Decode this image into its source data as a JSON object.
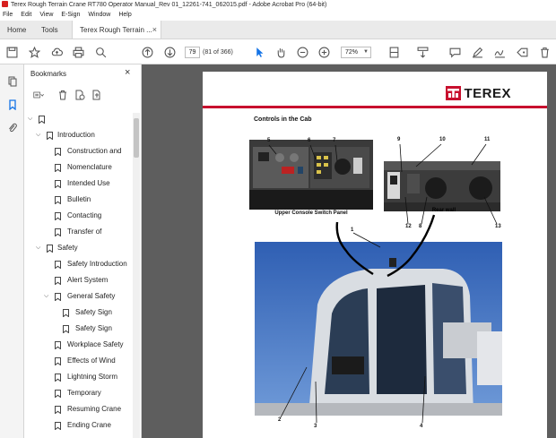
{
  "window": {
    "title": "Terex Rough Terrain Crane RT780 Operator Manual_Rev 01_12261-741_062015.pdf - Adobe Acrobat Pro (64-bit)"
  },
  "menu": [
    "File",
    "Edit",
    "View",
    "E-Sign",
    "Window",
    "Help"
  ],
  "tabs": {
    "home": "Home",
    "tools": "Tools",
    "document": "Terex Rough Terrain ..."
  },
  "toolbar": {
    "page_number": "79",
    "page_count": "(81 of 366)",
    "zoom": "72%"
  },
  "bookmarks": {
    "title": "Bookmarks",
    "items": [
      {
        "label": "",
        "expanded": true
      },
      {
        "label": "Introduction",
        "expanded": true
      },
      {
        "label": "Construction and"
      },
      {
        "label": "Nomenclature"
      },
      {
        "label": "Intended Use"
      },
      {
        "label": "Bulletin"
      },
      {
        "label": "Contacting"
      },
      {
        "label": "Transfer of"
      },
      {
        "label": "Safety",
        "expanded": true
      },
      {
        "label": "Safety Introduction"
      },
      {
        "label": "Alert System"
      },
      {
        "label": "General Safety",
        "expanded": true
      },
      {
        "label": "Safety Sign"
      },
      {
        "label": "Safety Sign"
      },
      {
        "label": "Workplace Safety"
      },
      {
        "label": "Effects of Wind"
      },
      {
        "label": "Lightning Storm"
      },
      {
        "label": "Temporary"
      },
      {
        "label": "Resuming Crane"
      },
      {
        "label": "Ending Crane"
      }
    ]
  },
  "document_page": {
    "brand": "TEREX",
    "heading": "Controls in the Cab",
    "captions": {
      "upper": "Upper Console Switch Panel",
      "rear": "Rear wall"
    },
    "callouts": [
      "1",
      "2",
      "3",
      "4",
      "5",
      "6",
      "7",
      "8",
      "9",
      "10",
      "11",
      "12",
      "13"
    ]
  },
  "colors": {
    "brand_red": "#c8102e",
    "viewer_bg": "#5e5e5e",
    "sky": "#3f6fc0"
  }
}
